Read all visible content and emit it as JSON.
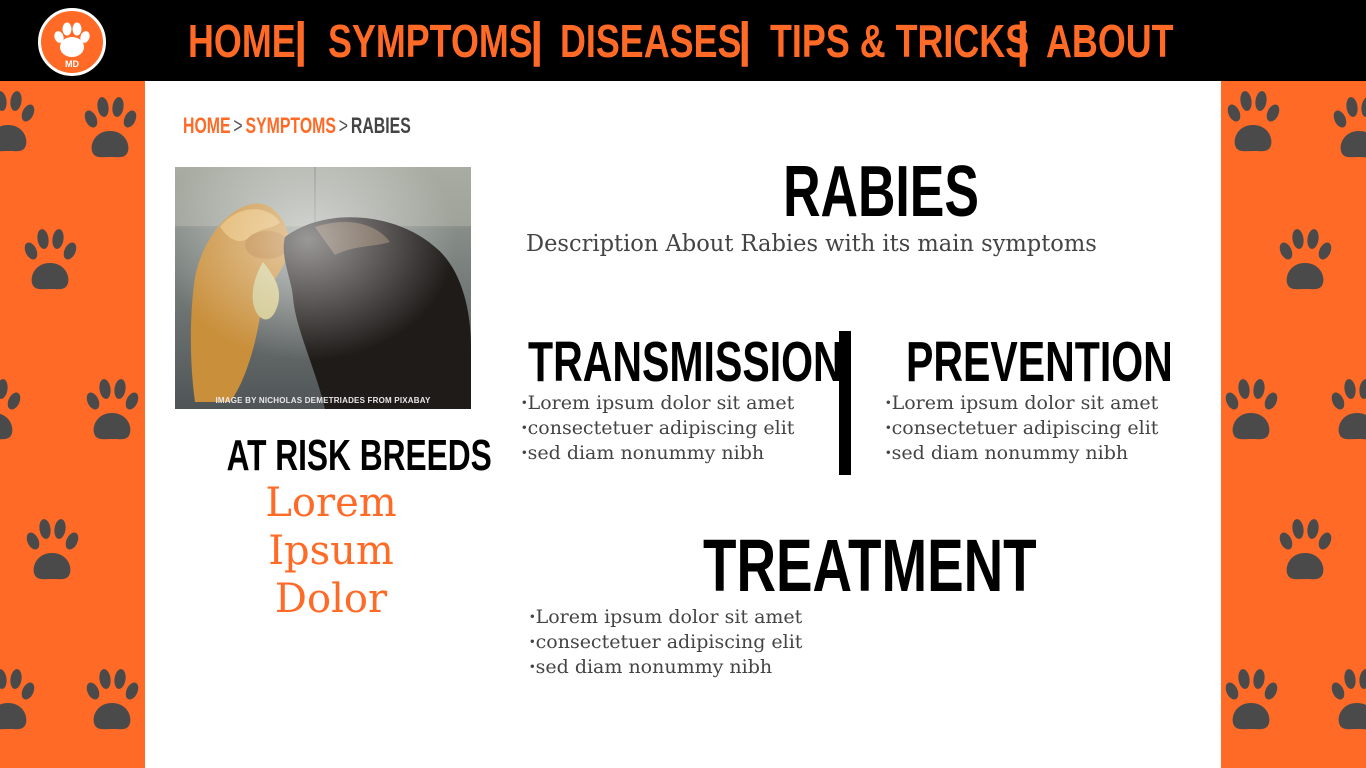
{
  "header": {
    "logo_text": "MD",
    "nav": [
      {
        "label": "HOME"
      },
      {
        "label": "SYMPTOMS"
      },
      {
        "label": "DISEASES"
      },
      {
        "label": "TIPS & TRICKS"
      },
      {
        "label": "ABOUT"
      }
    ],
    "separator": "|"
  },
  "breadcrumb": {
    "home": "HOME",
    "symptoms": "SYMPTOMS",
    "current": "RABIES",
    "sep": ">"
  },
  "image": {
    "credit": "IMAGE BY NICHOLAS DEMETRIADES FROM PIXABAY"
  },
  "risk": {
    "title": "AT RISK BREEDS",
    "breeds": [
      "Lorem",
      "Ipsum",
      "Dolor"
    ]
  },
  "main": {
    "title": "RABIES",
    "description": "Description About Rabies with its main symptoms"
  },
  "sections": {
    "transmission": {
      "title": "TRANSMISSION",
      "items": [
        "Lorem ipsum dolor sit amet",
        "consectetuer adipiscing elit",
        "sed diam nonummy nibh"
      ]
    },
    "prevention": {
      "title": "PREVENTION",
      "items": [
        "Lorem ipsum dolor sit amet",
        "consectetuer adipiscing elit",
        "sed diam nonummy nibh"
      ]
    },
    "treatment": {
      "title": "TREATMENT",
      "items": [
        "Lorem ipsum dolor sit amet",
        "consectetuer adipiscing elit",
        "sed diam nonummy nibh"
      ]
    }
  },
  "colors": {
    "accent": "#ff6a26",
    "header_bg": "#000000",
    "paw": "#4a4a4a",
    "text_body": "#444444"
  },
  "icons": [
    "paw-logo-icon",
    "paw-print-icon"
  ]
}
